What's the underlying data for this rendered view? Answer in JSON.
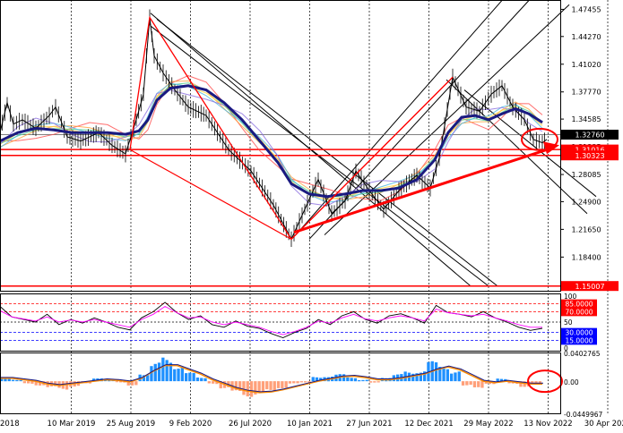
{
  "chart_data": {
    "type": "line",
    "panels": {
      "price": {
        "ylim": [
          1.1445,
          1.4855
        ],
        "y_ticks": [
          1.47455,
          1.4427,
          1.4102,
          1.3777,
          1.34585,
          1.31335,
          1.28085,
          1.249,
          1.2165,
          1.184
        ],
        "y_tick_labels": [
          "1.47455",
          "1.44270",
          "1.41020",
          "1.37770",
          "1.34585",
          "1.31335",
          "1.28085",
          "1.24900",
          "1.21650",
          "1.18400"
        ],
        "current_price": 1.3276,
        "current_price_label": "1.32760",
        "horizontal_levels": [
          {
            "value": 1.31016,
            "label": "1.31016",
            "color": "#ff0000"
          },
          {
            "value": 1.30323,
            "label": "1.30323",
            "color": "#ff0000"
          },
          {
            "value": 1.15007,
            "label": "1.15007",
            "color": "#ff0000"
          }
        ],
        "price_path": [
          [
            0,
            1.33
          ],
          [
            8,
            1.365
          ],
          [
            15,
            1.34
          ],
          [
            25,
            1.345
          ],
          [
            40,
            1.335
          ],
          [
            55,
            1.35
          ],
          [
            62,
            1.36
          ],
          [
            75,
            1.325
          ],
          [
            90,
            1.32
          ],
          [
            110,
            1.33
          ],
          [
            125,
            1.315
          ],
          [
            140,
            1.305
          ],
          [
            152,
            1.345
          ],
          [
            160,
            1.375
          ],
          [
            167,
            1.465
          ],
          [
            172,
            1.42
          ],
          [
            182,
            1.4
          ],
          [
            195,
            1.38
          ],
          [
            210,
            1.36
          ],
          [
            230,
            1.35
          ],
          [
            255,
            1.31
          ],
          [
            280,
            1.285
          ],
          [
            305,
            1.245
          ],
          [
            325,
            1.205
          ],
          [
            340,
            1.24
          ],
          [
            355,
            1.275
          ],
          [
            370,
            1.235
          ],
          [
            385,
            1.25
          ],
          [
            397,
            1.285
          ],
          [
            412,
            1.262
          ],
          [
            428,
            1.24
          ],
          [
            445,
            1.262
          ],
          [
            465,
            1.28
          ],
          [
            480,
            1.265
          ],
          [
            490,
            1.3
          ],
          [
            505,
            1.395
          ],
          [
            520,
            1.36
          ],
          [
            535,
            1.355
          ],
          [
            548,
            1.375
          ],
          [
            560,
            1.385
          ],
          [
            572,
            1.36
          ],
          [
            585,
            1.345
          ],
          [
            595,
            1.322
          ],
          [
            605,
            1.318
          ],
          [
            610,
            1.322
          ]
        ],
        "ema_path": [
          [
            0,
            1.32
          ],
          [
            20,
            1.33
          ],
          [
            40,
            1.335
          ],
          [
            60,
            1.333
          ],
          [
            80,
            1.33
          ],
          [
            100,
            1.33
          ],
          [
            120,
            1.33
          ],
          [
            140,
            1.328
          ],
          [
            155,
            1.332
          ],
          [
            165,
            1.345
          ],
          [
            175,
            1.368
          ],
          [
            190,
            1.382
          ],
          [
            210,
            1.385
          ],
          [
            230,
            1.38
          ],
          [
            250,
            1.365
          ],
          [
            270,
            1.345
          ],
          [
            290,
            1.32
          ],
          [
            310,
            1.295
          ],
          [
            325,
            1.27
          ],
          [
            345,
            1.258
          ],
          [
            365,
            1.255
          ],
          [
            385,
            1.258
          ],
          [
            405,
            1.262
          ],
          [
            425,
            1.262
          ],
          [
            445,
            1.265
          ],
          [
            465,
            1.275
          ],
          [
            485,
            1.298
          ],
          [
            500,
            1.33
          ],
          [
            515,
            1.348
          ],
          [
            530,
            1.35
          ],
          [
            545,
            1.345
          ],
          [
            560,
            1.352
          ],
          [
            575,
            1.358
          ],
          [
            590,
            1.352
          ],
          [
            605,
            1.342
          ]
        ],
        "red_channel": [
          [
            145,
            1.31
          ],
          [
            167,
            1.465
          ],
          [
            325,
            1.205
          ],
          [
            505,
            1.395
          ]
        ],
        "red_trendline": [
          [
            328,
            1.213
          ],
          [
            610,
            1.31
          ]
        ],
        "arrow_label": "",
        "circle_at": [
          602,
          1.322
        ]
      },
      "oscillator": {
        "ylim": [
          -5,
          105
        ],
        "levels": [
          {
            "value": 100,
            "label": "100",
            "color": "#000000"
          },
          {
            "value": 85,
            "label": "85.0000",
            "color": "#ff0000"
          },
          {
            "value": 70,
            "label": "70.0000",
            "color": "#ff0000"
          },
          {
            "value": 50,
            "label": "50",
            "color": "#000000"
          },
          {
            "value": 30,
            "label": "30.0000",
            "color": "#0000ff"
          },
          {
            "value": 15,
            "label": "15.0000",
            "color": "#0000ff"
          },
          {
            "value": 0,
            "label": "0",
            "color": "#000000"
          }
        ],
        "series": [
          {
            "color": "#000000",
            "values": [
              80,
              60,
              55,
              50,
              65,
              45,
              55,
              48,
              58,
              50,
              40,
              35,
              58,
              70,
              88,
              68,
              55,
              62,
              45,
              40,
              52,
              42,
              38,
              28,
              20,
              30,
              38,
              55,
              45,
              62,
              70,
              55,
              48,
              62,
              66,
              58,
              48,
              82,
              68,
              65,
              60,
              70,
              58,
              50,
              40,
              34,
              38
            ]
          },
          {
            "color": "#ff00ff",
            "values": [
              72,
              60,
              56,
              52,
              60,
              50,
              54,
              50,
              55,
              50,
              45,
              40,
              55,
              65,
              80,
              68,
              58,
              60,
              50,
              45,
              50,
              45,
              40,
              32,
              26,
              32,
              40,
              52,
              48,
              58,
              65,
              56,
              52,
              58,
              62,
              58,
              52,
              75,
              68,
              65,
              62,
              65,
              58,
              52,
              45,
              40,
              40
            ]
          }
        ]
      },
      "macd": {
        "ylim": [
          -0.0449967,
          0.0402765
        ],
        "y_ticks": [
          0.0402765,
          0,
          -0.0449967
        ],
        "y_tick_labels": [
          "0.0402765",
          "0.00",
          "-0.0449967"
        ],
        "histogram": [
          0.004,
          0.002,
          -0.004,
          -0.006,
          -0.01,
          -0.012,
          -0.008,
          -0.004,
          0.004,
          0.002,
          -0.002,
          -0.006,
          0.012,
          0.026,
          0.034,
          0.024,
          0.012,
          0.006,
          -0.004,
          -0.01,
          -0.018,
          -0.022,
          -0.02,
          -0.016,
          -0.01,
          -0.004,
          -0.002,
          0.006,
          0.008,
          0.01,
          0.006,
          0.002,
          -0.002,
          0.006,
          0.01,
          0.014,
          0.016,
          0.028,
          0.024,
          0.014,
          -0.006,
          -0.012,
          -0.004,
          0.004,
          -0.004,
          -0.008,
          -0.004
        ],
        "signal_line": [
          0.004,
          0.004,
          0.002,
          0.0,
          -0.004,
          -0.006,
          -0.004,
          -0.002,
          0.0,
          0.002,
          0.001,
          -0.001,
          0.004,
          0.014,
          0.022,
          0.022,
          0.016,
          0.01,
          0.002,
          -0.004,
          -0.01,
          -0.014,
          -0.016,
          -0.015,
          -0.012,
          -0.008,
          -0.004,
          0.0,
          0.003,
          0.006,
          0.007,
          0.005,
          0.002,
          0.002,
          0.004,
          0.007,
          0.01,
          0.016,
          0.02,
          0.016,
          0.008,
          0.0,
          -0.002,
          0.0,
          -0.002,
          -0.004,
          -0.004
        ],
        "circle_at": [
          608,
          0.0
        ]
      }
    },
    "x_tick_labels": [
      "2018",
      "10 Mar 2019",
      "25 Aug 2019",
      "9 Feb 2020",
      "26 Jul 2020",
      "10 Jan 2021",
      "27 Jun 2021",
      "12 Dec 2021",
      "29 May 2022",
      "13 Nov 2022",
      "30 Apr 2023"
    ],
    "colors": {
      "ema": "#1a1a80",
      "price": "#000000",
      "level": "#ff0000",
      "current": "#000000",
      "oscillator_grid": "#ff0000",
      "macd_up": "#1e90ff",
      "macd_down": "#ffa07a",
      "signal": "#1a1a80",
      "annotation": "#ff0000"
    }
  }
}
